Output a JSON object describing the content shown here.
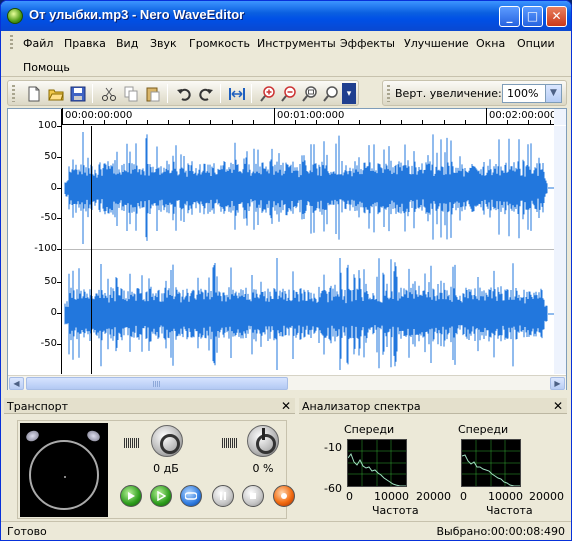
{
  "window": {
    "title": "От  улыбки.mp3 - Nero WaveEditor",
    "min": "_",
    "max": "□",
    "close": "✕"
  },
  "menu": [
    "Файл",
    "Правка",
    "Вид",
    "Звук",
    "Громкость",
    "Инструменты",
    "Эффекты",
    "Улучшение",
    "Окна",
    "Опции",
    "Помощь"
  ],
  "menu_underline": [
    "Ф",
    "П",
    "В",
    "З",
    "Г",
    "И",
    "Э",
    "У",
    "О",
    "О",
    "П"
  ],
  "zoom": {
    "label": "Верт. увеличение:",
    "value": "100%"
  },
  "timeline": [
    "00:00:00:000",
    "00:01:00:000",
    "00:02:00:000"
  ],
  "yaxis_labels": [
    "100",
    "50",
    "0",
    "-50",
    "-100",
    "100",
    "50",
    "0",
    "-50"
  ],
  "transport": {
    "title": "Транспорт",
    "close": "✕",
    "volume_value": "0 дБ",
    "balance_value": "0 %"
  },
  "spectrum": {
    "title": "Анализатор спектра",
    "close": "✕",
    "left_title": "Спереди",
    "right_title": "Спереди",
    "y_top": "-10",
    "y_bottom": "-60",
    "x_ticks": [
      "0",
      "10000",
      "20000"
    ],
    "x_label": "Частота"
  },
  "status": {
    "left": "Готово",
    "right": "Выбрано:00:00:08:490"
  },
  "colors": {
    "wave": "#2277dd",
    "title_bar": "#0a5fe0"
  }
}
